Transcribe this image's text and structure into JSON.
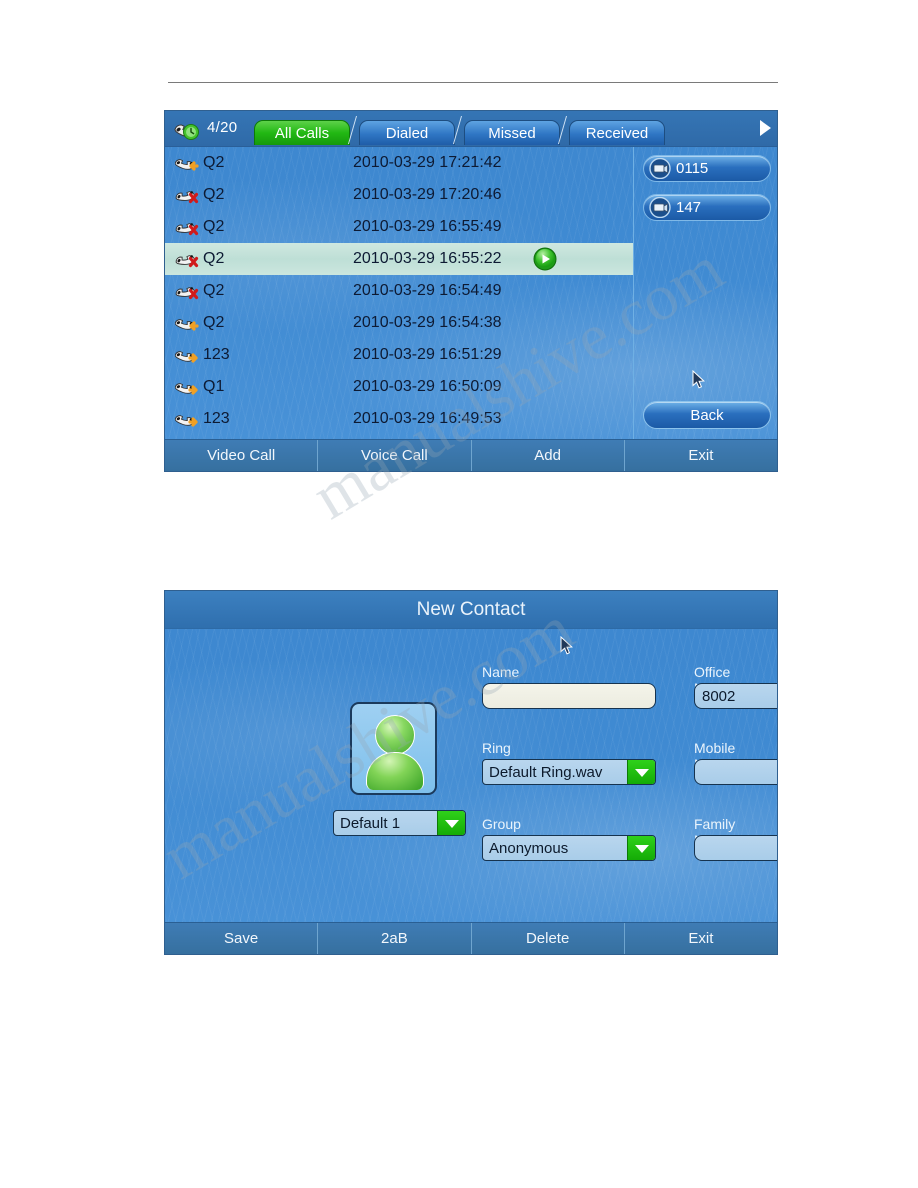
{
  "call_log": {
    "status_icon": "handset-clock-icon",
    "counter": "4/20",
    "tabs": [
      {
        "label": "All Calls",
        "active": true
      },
      {
        "label": "Dialed",
        "active": false
      },
      {
        "label": "Missed",
        "active": false
      },
      {
        "label": "Received",
        "active": false
      }
    ],
    "next_tab_icon": "play-right-icon",
    "rows": [
      {
        "icon": "incoming-call-icon",
        "name": "Q2",
        "time": "2010-03-29 17:21:42",
        "selected": false,
        "play": false
      },
      {
        "icon": "missed-call-icon",
        "name": "Q2",
        "time": "2010-03-29 17:20:46",
        "selected": false,
        "play": false
      },
      {
        "icon": "missed-call-icon",
        "name": "Q2",
        "time": "2010-03-29 16:55:49",
        "selected": false,
        "play": false
      },
      {
        "icon": "missed-call-icon",
        "name": "Q2",
        "time": "2010-03-29 16:55:22",
        "selected": true,
        "play": true
      },
      {
        "icon": "missed-call-icon",
        "name": "Q2",
        "time": "2010-03-29 16:54:49",
        "selected": false,
        "play": false
      },
      {
        "icon": "incoming-call-icon",
        "name": "Q2",
        "time": "2010-03-29 16:54:38",
        "selected": false,
        "play": false
      },
      {
        "icon": "outgoing-call-icon",
        "name": "123",
        "time": "2010-03-29 16:51:29",
        "selected": false,
        "play": false
      },
      {
        "icon": "outgoing-call-icon",
        "name": "Q1",
        "time": "2010-03-29 16:50:09",
        "selected": false,
        "play": false
      },
      {
        "icon": "outgoing-call-icon",
        "name": "123",
        "time": "2010-03-29 16:49:53",
        "selected": false,
        "play": false
      }
    ],
    "side_buttons": [
      {
        "icon": "videophone-icon",
        "label": "0115"
      },
      {
        "icon": "videophone-icon",
        "label": "147"
      }
    ],
    "back_label": "Back",
    "softkeys": [
      "Video Call",
      "Voice Call",
      "Add",
      "Exit"
    ],
    "play_icon": "play-circle-icon"
  },
  "new_contact": {
    "title": "New Contact",
    "avatar_icon": "user-avatar-icon",
    "account_select": {
      "value": "Default 1"
    },
    "fields": {
      "name": {
        "label": "Name",
        "value": ""
      },
      "ring": {
        "label": "Ring",
        "value": "Default Ring.wav"
      },
      "group": {
        "label": "Group",
        "value": "Anonymous"
      },
      "office_number": {
        "label": "Office Number",
        "value": "8002"
      },
      "mobile_number": {
        "label": "Mobile Number",
        "value": ""
      },
      "family_number": {
        "label": "Family Number",
        "value": ""
      }
    },
    "softkeys": [
      "Save",
      "2aB",
      "Delete",
      "Exit"
    ]
  },
  "watermark": {
    "line1": "manualshive.com",
    "line2": "manualshive.com"
  },
  "colors": {
    "accent_green": "#22b813",
    "panel_blue": "#3f8ad2",
    "bar_blue": "#36709f",
    "selected_row": "#c3e2d9"
  }
}
